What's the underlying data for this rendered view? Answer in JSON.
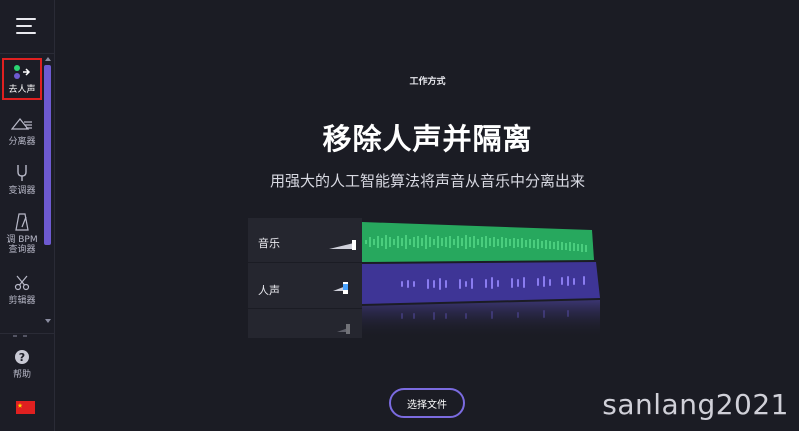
{
  "sidebar": {
    "items": [
      {
        "label": "去人声",
        "icon": "vocal-remover-icon",
        "active": true
      },
      {
        "label": "分离器",
        "icon": "splitter-icon"
      },
      {
        "label": "变调器",
        "icon": "tuning-fork-icon"
      },
      {
        "label_line1": "调 BPM",
        "label_line2": "查询器",
        "icon": "metronome-icon"
      },
      {
        "label": "剪辑器",
        "icon": "scissors-icon"
      }
    ],
    "help_label": "帮助",
    "language_flag": "china-flag-icon"
  },
  "main": {
    "section_label": "工作方式",
    "headline": "移除人声并隔离",
    "subline": "用强大的人工智能算法将声音从音乐中分离出来",
    "tracks": [
      {
        "label": "音乐",
        "color": "#2bb866"
      },
      {
        "label": "人声",
        "color": "#5b4fc0"
      }
    ],
    "choose_file_button": "选择文件"
  },
  "watermark": "sanlang2021",
  "colors": {
    "accent": "#6d5ad0",
    "active_outline": "#e02020",
    "music_wave": "#3ee07a",
    "vocal_wave": "#7c6ee6"
  }
}
